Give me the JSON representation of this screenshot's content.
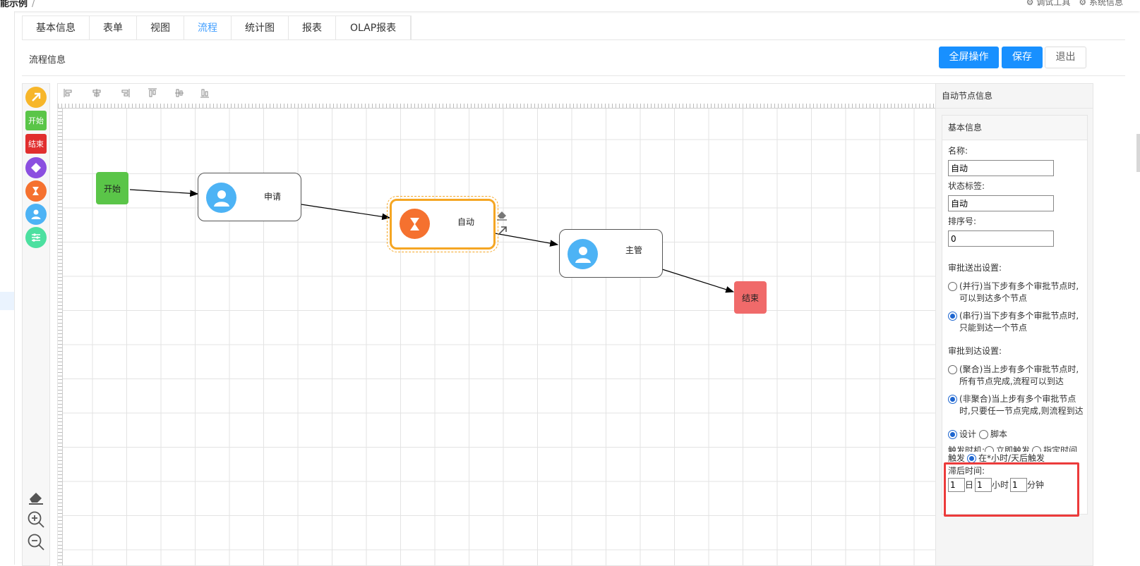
{
  "header": {
    "breadcrumb": "能示例",
    "breadcrumb_sep": "/",
    "debug_tool": "调试工具",
    "system_info": "系统信息"
  },
  "tabs": [
    "基本信息",
    "表单",
    "视图",
    "流程",
    "统计图",
    "报表",
    "OLAP报表"
  ],
  "active_tab": "流程",
  "section_title": "流程信息",
  "buttons": {
    "fullscreen": "全屏操作",
    "save": "保存",
    "exit": "退出"
  },
  "palette": {
    "pointer": "arrow-pointer-icon",
    "start": "开始",
    "end": "结束",
    "diamond": "decision-diamond-icon",
    "auto": "auto-node-icon",
    "user": "user-node-icon",
    "sliders": "sliders-icon",
    "eraser": "eraser-icon",
    "zoom_in": "zoom-in-icon",
    "zoom_out": "zoom-out-icon"
  },
  "nodes": {
    "start": "开始",
    "apply": "申请",
    "auto": "自动",
    "manager": "主管",
    "end": "结束"
  },
  "colors": {
    "start": "#5ac548",
    "end": "#f06a6a",
    "user_icon": "#4db3f5",
    "auto_icon": "#f5712f",
    "selection": "#f5a623",
    "primary": "#1890ff",
    "highlight": "#ec3b3b"
  },
  "panel": {
    "title": "自动节点信息",
    "box_title": "基本信息",
    "name_label": "名称:",
    "name_value": "自动",
    "status_label": "状态标签:",
    "status_value": "自动",
    "order_label": "排序号:",
    "order_value": "0",
    "send_label": "审批送出设置:",
    "send_opt1": "(并行)当下步有多个审批节点时,可以到达多个节点",
    "send_opt2": "(串行)当下步有多个审批节点时,只能到达一个节点",
    "arrive_label": "审批到达设置:",
    "arrive_opt1": "(聚合)当上步有多个审批节点时,所有节点完成,流程可以到达",
    "arrive_opt2": "(非聚合)当上步有多个审批节点时,只要任一节点完成,则流程到达",
    "mode_design": "设计",
    "mode_script": "脚本",
    "trigger_label": "触发时机:",
    "trigger_now": "立即触发",
    "trigger_time": "指定时间",
    "trigger_prefix": "触发",
    "trigger_after": "在*小时/天后触发",
    "delay_label": "滞后时间:",
    "delay_day_value": "1",
    "delay_day_unit": "日",
    "delay_hour_value": "1",
    "delay_hour_unit": "小时",
    "delay_min_value": "1",
    "delay_min_unit": "分钟"
  }
}
